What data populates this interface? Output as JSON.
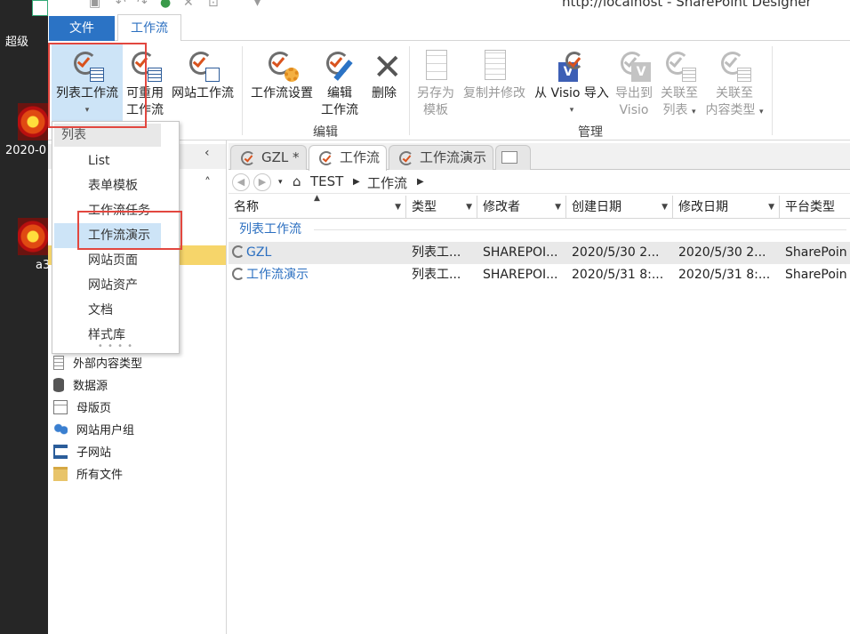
{
  "app": {
    "title": "http://localhost - SharePoint Designer"
  },
  "desktop": {
    "icons": [
      {
        "label": "超级",
        "icon": "shortcut-icon"
      },
      {
        "label": "2020-0",
        "icon": "flower-image-icon"
      },
      {
        "label": "a3",
        "icon": "flower-image-icon"
      }
    ]
  },
  "tabs": {
    "file": "文件",
    "workflow": "工作流"
  },
  "ribbon": {
    "new_group": {
      "list_workflow": "列表工作流",
      "reusable_workflow_line1": "可重用",
      "reusable_workflow_line2": "工作流",
      "site_workflow": "网站工作流"
    },
    "edit_group": {
      "label": "编辑",
      "workflow_settings": "工作流设置",
      "edit_line1": "编辑",
      "edit_line2": "工作流",
      "delete": "删除"
    },
    "manage_group": {
      "label": "管理",
      "save_as_template_line1": "另存为",
      "save_as_template_line2": "模板",
      "copy_modify": "复制并修改",
      "import_from_visio": "从 Visio 导入",
      "export_to_visio_line1": "导出到",
      "export_to_visio_line2": "Visio",
      "associate_list_line1": "关联至",
      "associate_list_line2": "列表",
      "associate_ct_line1": "关联至",
      "associate_ct_line2": "内容类型"
    }
  },
  "dropdown": {
    "header": "列表",
    "items": [
      "List",
      "表单模板",
      "工作流任务",
      "工作流演示",
      "网站页面",
      "网站资产",
      "文档",
      "样式库"
    ],
    "highlighted": "工作流演示"
  },
  "nav": {
    "items": [
      {
        "label": "外部内容类型",
        "icon": "external-content-icon"
      },
      {
        "label": "数据源",
        "icon": "database-icon"
      },
      {
        "label": "母版页",
        "icon": "master-page-icon"
      },
      {
        "label": "网站用户组",
        "icon": "users-group-icon"
      },
      {
        "label": "子网站",
        "icon": "subsite-icon"
      },
      {
        "label": "所有文件",
        "icon": "folder-icon"
      }
    ]
  },
  "doc_tabs": [
    {
      "label": "GZL *",
      "active": false
    },
    {
      "label": "工作流",
      "active": true
    },
    {
      "label": "工作流演示",
      "active": false
    }
  ],
  "breadcrumb": {
    "site": "TEST",
    "section": "工作流"
  },
  "table": {
    "columns": [
      "名称",
      "类型",
      "修改者",
      "创建日期",
      "修改日期",
      "平台类型"
    ],
    "group_label": "列表工作流",
    "rows": [
      {
        "name": "GZL",
        "type": "列表工...",
        "modified_by": "SHAREPOI...",
        "created": "2020/5/30 2...",
        "modified": "2020/5/30 2...",
        "platform": "SharePoin"
      },
      {
        "name": "工作流演示",
        "type": "列表工...",
        "modified_by": "SHAREPOI...",
        "created": "2020/5/31 8:...",
        "modified": "2020/5/31 8:...",
        "platform": "SharePoin"
      }
    ]
  },
  "colors": {
    "accent": "#2b73c5",
    "highlight_box": "#e2473f",
    "selection": "#cde4f7"
  }
}
